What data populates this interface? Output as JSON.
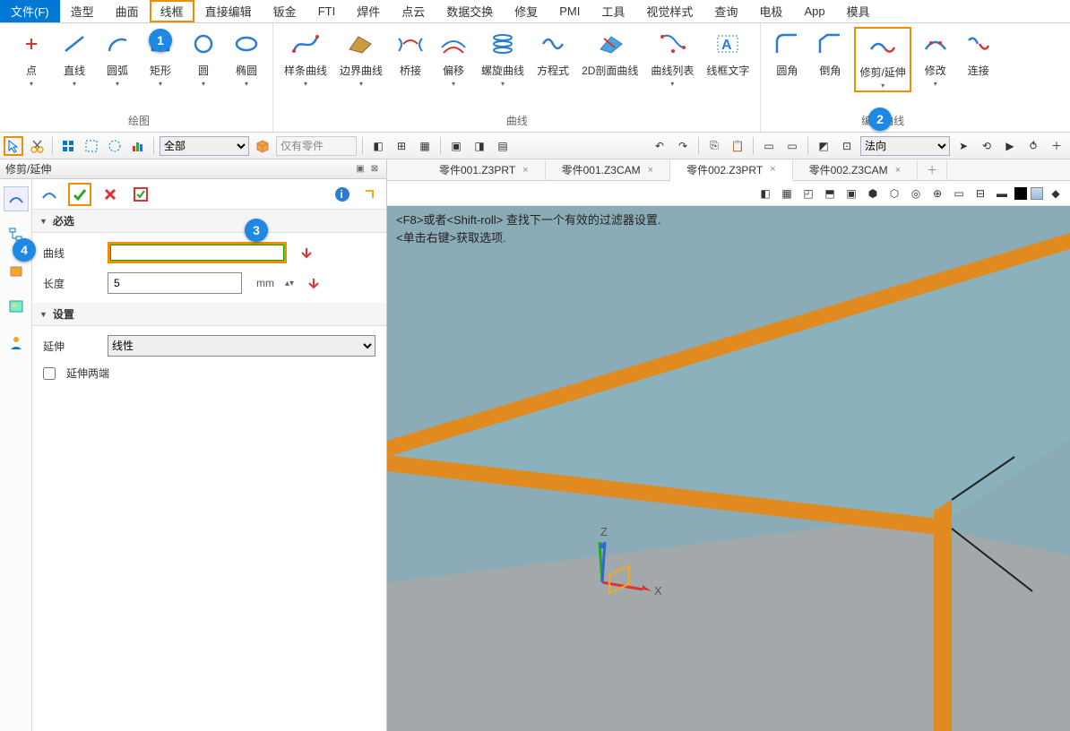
{
  "menu": {
    "file": "文件(F)",
    "items": [
      "造型",
      "曲面",
      "线框",
      "直接编辑",
      "钣金",
      "FTI",
      "焊件",
      "点云",
      "数据交换",
      "修复",
      "PMI",
      "工具",
      "视觉样式",
      "查询",
      "电极",
      "App",
      "模具"
    ]
  },
  "ribbon": {
    "group1": {
      "title": "绘图",
      "items": [
        "点",
        "直线",
        "圆弧",
        "矩形",
        "圆",
        "椭圆"
      ]
    },
    "group2": {
      "title": "曲线",
      "items": [
        "样条曲线",
        "边界曲线",
        "桥接",
        "偏移",
        "螺旋曲线",
        "方程式",
        "2D剖面曲线",
        "曲线列表",
        "线框文字"
      ]
    },
    "group3": {
      "title": "编辑曲线",
      "items": [
        "圆角",
        "倒角",
        "修剪/延伸",
        "修改",
        "连接"
      ]
    }
  },
  "qtb": {
    "sel_all": "全部",
    "sel_only": "仅有零件",
    "sel_normal": "法向"
  },
  "panel": {
    "title": "修剪/延伸",
    "sect_required": "必选",
    "curve_label": "曲线",
    "length_label": "长度",
    "length_value": "5",
    "length_unit": "mm",
    "sect_settings": "设置",
    "extend_label": "延伸",
    "extend_value": "线性",
    "both_ends": "延伸两端"
  },
  "tabs": [
    "零件001.Z3PRT",
    "零件001.Z3CAM",
    "零件002.Z3PRT",
    "零件002.Z3CAM"
  ],
  "active_tab": 2,
  "hint1": "<F8>或者<Shift-roll> 查找下一个有效的过滤器设置.",
  "hint2": "<单击右键>获取选项.",
  "axes": {
    "x": "X",
    "z": "Z"
  },
  "badges": [
    "1",
    "2",
    "3",
    "4"
  ]
}
